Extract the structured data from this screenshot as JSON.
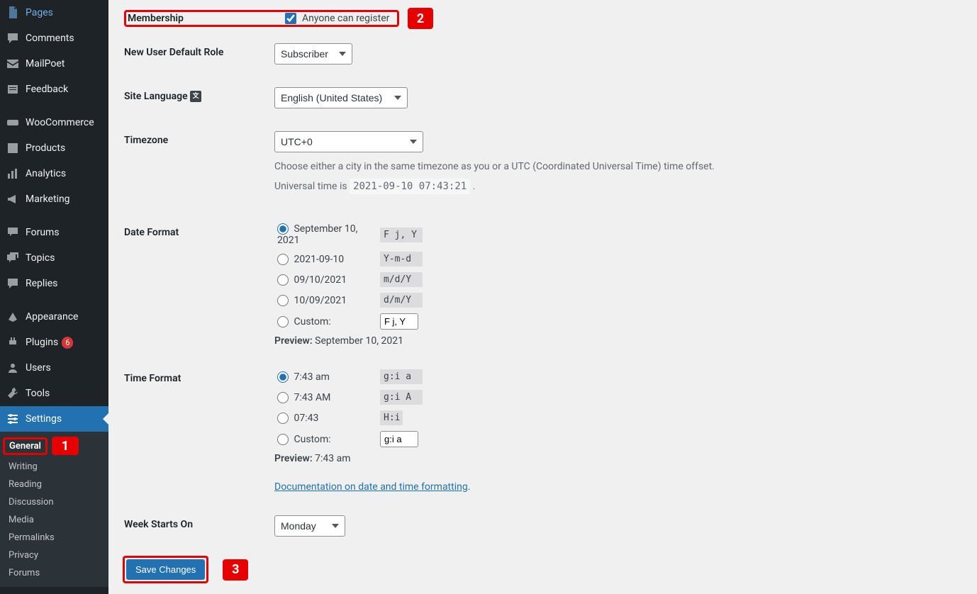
{
  "sidebar": {
    "items": [
      {
        "label": "Pages",
        "icon": "pages"
      },
      {
        "label": "Comments",
        "icon": "comments"
      },
      {
        "label": "MailPoet",
        "icon": "mailpoet"
      },
      {
        "label": "Feedback",
        "icon": "feedback"
      },
      {
        "label": "WooCommerce",
        "icon": "woo"
      },
      {
        "label": "Products",
        "icon": "products"
      },
      {
        "label": "Analytics",
        "icon": "analytics"
      },
      {
        "label": "Marketing",
        "icon": "marketing"
      },
      {
        "label": "Forums",
        "icon": "forums"
      },
      {
        "label": "Topics",
        "icon": "topics"
      },
      {
        "label": "Replies",
        "icon": "replies"
      },
      {
        "label": "Appearance",
        "icon": "appearance"
      },
      {
        "label": "Plugins",
        "icon": "plugins",
        "badge": "6"
      },
      {
        "label": "Users",
        "icon": "users"
      },
      {
        "label": "Tools",
        "icon": "tools"
      },
      {
        "label": "Settings",
        "icon": "settings"
      }
    ],
    "submenu": {
      "items": [
        "General",
        "Writing",
        "Reading",
        "Discussion",
        "Media",
        "Permalinks",
        "Privacy",
        "Forums"
      ]
    }
  },
  "form": {
    "membership": {
      "label": "Membership",
      "checkbox_label": "Anyone can register"
    },
    "new_user_role": {
      "label": "New User Default Role",
      "value": "Subscriber"
    },
    "site_language": {
      "label": "Site Language",
      "value": "English (United States)"
    },
    "timezone": {
      "label": "Timezone",
      "value": "UTC+0",
      "description": "Choose either a city in the same timezone as you or a UTC (Coordinated Universal Time) time offset.",
      "universal_prefix": "Universal time is ",
      "universal_value": "2021-09-10 07:43:21",
      "universal_suffix": " ."
    },
    "date_format": {
      "label": "Date Format",
      "options": [
        {
          "label": "September 10, 2021",
          "code": "F j, Y"
        },
        {
          "label": "2021-09-10",
          "code": "Y-m-d"
        },
        {
          "label": "09/10/2021",
          "code": "m/d/Y"
        },
        {
          "label": "10/09/2021",
          "code": "d/m/Y"
        }
      ],
      "custom_label": "Custom:",
      "custom_value": "F j, Y",
      "preview_label": "Preview:",
      "preview_value": " September 10, 2021"
    },
    "time_format": {
      "label": "Time Format",
      "options": [
        {
          "label": "7:43 am",
          "code": "g:i a"
        },
        {
          "label": "7:43 AM",
          "code": "g:i A"
        },
        {
          "label": "07:43",
          "code": "H:i"
        }
      ],
      "custom_label": "Custom:",
      "custom_value": "g:i a",
      "preview_label": "Preview:",
      "preview_value": " 7:43 am",
      "doc_link": "Documentation on date and time formatting"
    },
    "week_starts": {
      "label": "Week Starts On",
      "value": "Monday"
    },
    "save_button": "Save Changes"
  },
  "annotations": {
    "tag1": "1",
    "tag2": "2",
    "tag3": "3"
  }
}
